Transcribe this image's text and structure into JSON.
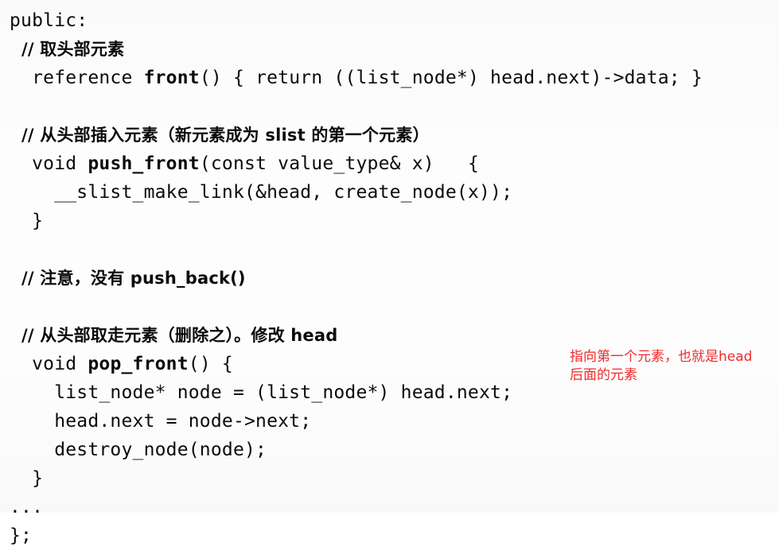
{
  "page": {
    "kind": "scanned-book-code-listing",
    "background_color": "#fdfdfd",
    "text_color": "#0b0b0b",
    "annotation_color": "#ef2b2b"
  },
  "code": {
    "language": "C++",
    "lines": [
      {
        "id": "l01",
        "indent": 0,
        "text": "public:"
      },
      {
        "id": "l02",
        "indent": 1,
        "text": "// 取头部元素",
        "script": "cjk"
      },
      {
        "id": "l03",
        "indent": 1,
        "pre": "reference ",
        "bold": "front",
        "post": "() { return ((list_node*) head.next)->data; }"
      },
      {
        "id": "l04",
        "indent": 0,
        "text": ""
      },
      {
        "id": "l05",
        "indent": 1,
        "text": "// 从头部插入元素（新元素成为 slist 的第一个元素）",
        "script": "cjk"
      },
      {
        "id": "l06",
        "indent": 1,
        "pre": "void ",
        "bold": "push_front",
        "post": "(const value_type& x)   {"
      },
      {
        "id": "l07",
        "indent": 2,
        "text": "__slist_make_link(&head, create_node(x));"
      },
      {
        "id": "l08",
        "indent": 1,
        "text": "}"
      },
      {
        "id": "l09",
        "indent": 0,
        "text": ""
      },
      {
        "id": "l10",
        "indent": 1,
        "text": "// 注意，没有 push_back()",
        "script": "cjk"
      },
      {
        "id": "l11",
        "indent": 0,
        "text": ""
      },
      {
        "id": "l12",
        "indent": 1,
        "text": "// 从头部取走元素（删除之）。修改 head",
        "script": "cjk"
      },
      {
        "id": "l13",
        "indent": 1,
        "pre": "void ",
        "bold": "pop_front",
        "post": "() {"
      },
      {
        "id": "l14",
        "indent": 2,
        "text": "list_node* node = (list_node*) head.next;"
      },
      {
        "id": "l15",
        "indent": 2,
        "text": "head.next = node->next;"
      },
      {
        "id": "l16",
        "indent": 2,
        "text": "destroy_node(node);"
      },
      {
        "id": "l17",
        "indent": 1,
        "text": "}"
      },
      {
        "id": "l18",
        "indent": 0,
        "text": "..."
      },
      {
        "id": "l19",
        "indent": 0,
        "text": "};"
      }
    ]
  },
  "annotation": {
    "color": "#ef2b2b",
    "lines": [
      "指向第一个元素，也就是head",
      "后面的元素"
    ]
  }
}
